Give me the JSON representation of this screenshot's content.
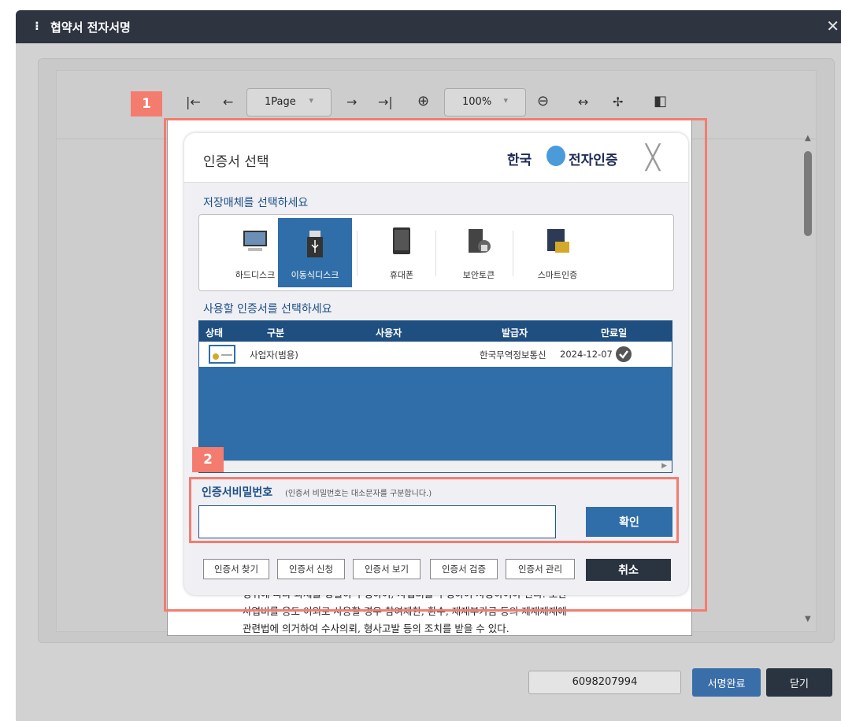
{
  "window": {
    "title": "협약서 전자서명",
    "grip": "⁝",
    "close": "✕"
  },
  "toolbar": {
    "first": "|←",
    "prev": "←",
    "page_value": "1Page",
    "next": "→",
    "last": "→|",
    "zoom_in": "⊕",
    "zoom_value": "100%",
    "zoom_out": "⊖",
    "fit_width": "↔",
    "fit_page": "✢",
    "panel": "◧"
  },
  "document": {
    "lines": [
      "정뒤에 따라 과제를 성실히 수행하여, 사업비를 수행하여 사용하여야 한다. 또한",
      "사업비를 용도 이외로 사용할 경우 참여제한, 환수, 제재부가금 등의 제재제재에",
      "관련법에 의거하여 수사의뢰, 형사고발 등의 조치를 받을 수 있다."
    ]
  },
  "callouts": {
    "c1": "1",
    "c2": "2"
  },
  "dialog": {
    "title": "인증서 선택",
    "brand_left": "한국",
    "brand_right": "전자인증",
    "close": "╳",
    "media_label": "저장매체를 선택하세요",
    "media": [
      {
        "label": "하드디스크"
      },
      {
        "label": "이동식디스크"
      },
      {
        "label": "휴대폰"
      },
      {
        "label": "보안토큰"
      },
      {
        "label": "스마트인증"
      }
    ],
    "cert_label": "사용할 인증서를 선택하세요",
    "cert_headers": [
      "상태",
      "구분",
      "사용자",
      "발급자",
      "만료일"
    ],
    "cert_rows": [
      {
        "type": "사업자(범용)",
        "issuer": "한국무역정보통신",
        "expiry": "2024-12-07"
      }
    ],
    "pw_label": "인증서비밀번호",
    "pw_hint": "(인증서 비밀번호는 대소문자를 구분합니다.)",
    "pw_value": "",
    "ok": "확인",
    "buttons": [
      "인증서 찾기",
      "인증서 신청",
      "인증서 보기",
      "인증서 검증",
      "인증서 관리"
    ],
    "cancel": "취소"
  },
  "footer": {
    "number": "6098207994",
    "sign": "서명완료",
    "close": "닫기"
  }
}
